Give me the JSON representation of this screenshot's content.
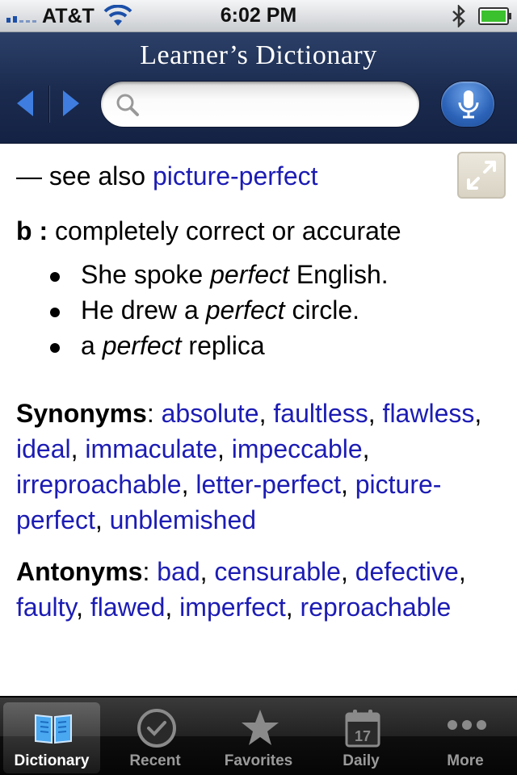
{
  "status_bar": {
    "carrier": "AT&T",
    "time": "6:02 PM",
    "signal_bars": 2,
    "battery_level": 1.0
  },
  "nav": {
    "title": "Learner’s Dictionary",
    "search_value": "",
    "search_placeholder": ""
  },
  "content": {
    "see_also_prefix": "— see also",
    "see_also_link": "picture-perfect",
    "sense_letter": "b :",
    "sense_definition": "completely correct or accurate",
    "examples": [
      {
        "before": "She spoke ",
        "italic": "perfect",
        "after": " English."
      },
      {
        "before": "He drew a ",
        "italic": "perfect",
        "after": " circle."
      },
      {
        "before": "a ",
        "italic": "perfect",
        "after": " replica"
      }
    ],
    "synonyms_label": "Synonyms",
    "synonyms": [
      "absolute",
      "faultless",
      "flawless",
      "ideal",
      "immaculate",
      "impeccable",
      "irreproachable",
      "letter-perfect",
      "picture-perfect",
      "unblemished"
    ],
    "antonyms_label": "Antonyms",
    "antonyms": [
      "bad",
      "censurable",
      "defective",
      "faulty",
      "flawed",
      "imperfect",
      "reproachable"
    ]
  },
  "tabs": [
    {
      "label": "Dictionary",
      "icon": "book-icon",
      "active": true
    },
    {
      "label": "Recent",
      "icon": "clock-check-icon",
      "active": false
    },
    {
      "label": "Favorites",
      "icon": "star-icon",
      "active": false
    },
    {
      "label": "Daily",
      "icon": "calendar-icon",
      "date": "17",
      "active": false
    },
    {
      "label": "More",
      "icon": "more-dots-icon",
      "active": false
    }
  ],
  "colors": {
    "link": "#1c1cb4",
    "nav_bar": "#1a2a4e",
    "tab_active_icon": "#4aa8f0"
  }
}
